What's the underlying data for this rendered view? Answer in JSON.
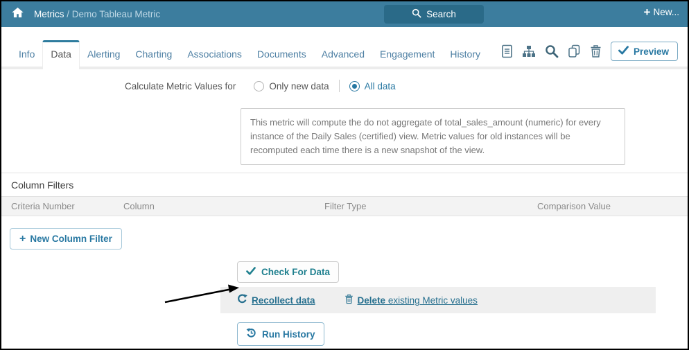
{
  "header": {
    "breadcrumb": {
      "root": "Metrics",
      "separator": " / ",
      "current": "Demo Tableau Metric"
    },
    "search_label": "Search",
    "new_plus": "+",
    "new_label": "New..."
  },
  "tabs": {
    "items": [
      "Info",
      "Data",
      "Alerting",
      "Charting",
      "Associations",
      "Documents",
      "Advanced",
      "Engagement",
      "History"
    ],
    "active": "Data"
  },
  "toolbar": {
    "icon_names": [
      "document-icon",
      "sitemap-icon",
      "search-icon",
      "copy-icon",
      "trash-icon"
    ],
    "preview_label": "Preview"
  },
  "calculate_row": {
    "label": "Calculate Metric Values for",
    "options": [
      {
        "label": "Only new data",
        "selected": false
      },
      {
        "label": "All data",
        "selected": true
      }
    ]
  },
  "description_box": {
    "text": "This metric will compute the do not aggregate of total_sales_amount (numeric) for every instance of the Daily Sales (certified) view. Metric values for old instances will be recomputed each time there is a new snapshot of the view."
  },
  "column_filters": {
    "title": "Column Filters",
    "headers": [
      "Criteria Number",
      "Column",
      "Filter Type",
      "Comparison Value"
    ],
    "rows": [],
    "new_filter_plus": "+",
    "new_filter_label": "New Column Filter"
  },
  "actions": {
    "check_for_data_label": "Check For Data",
    "recollect_label": "Recollect data",
    "delete_label_bold": "Delete",
    "delete_label_rest": " existing Metric values",
    "run_history_label": "Run History"
  },
  "colors": {
    "header_bg": "#3C7D9E",
    "search_button_bg": "#2A6A88",
    "accent": "#2878A2",
    "tab_active_border": "#2E7C9E",
    "link": "#27708F",
    "check_teal": "#1E7F8E"
  }
}
